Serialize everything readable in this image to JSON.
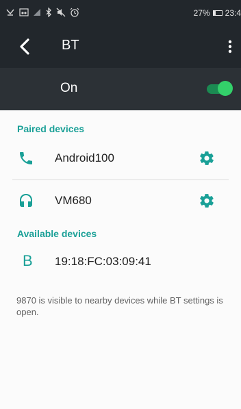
{
  "status_bar": {
    "left_icons": [
      "missed-call-icon",
      "voicemail-icon",
      "signal-icon",
      "bluetooth-icon",
      "mute-icon",
      "alarm-icon"
    ],
    "battery": "27%",
    "time": "23:4"
  },
  "app_bar": {
    "title": "BT"
  },
  "master_switch": {
    "label": "On",
    "on": true
  },
  "paired": {
    "header": "Paired devices",
    "devices": [
      {
        "name": "Android100",
        "icon": "phone-icon"
      },
      {
        "name": "VM680",
        "icon": "headset-icon"
      }
    ]
  },
  "available": {
    "header": "Available devices",
    "devices": [
      {
        "name": "19:18:FC:03:09:41",
        "icon": "bluetooth-letter-icon",
        "glyph": "B"
      }
    ]
  },
  "footer": {
    "note": "9870 is visible to nearby devices while BT settings is open."
  },
  "colors": {
    "accent": "#1aa097",
    "toolbar": "#22272c",
    "switch_on": "#33d06a"
  }
}
